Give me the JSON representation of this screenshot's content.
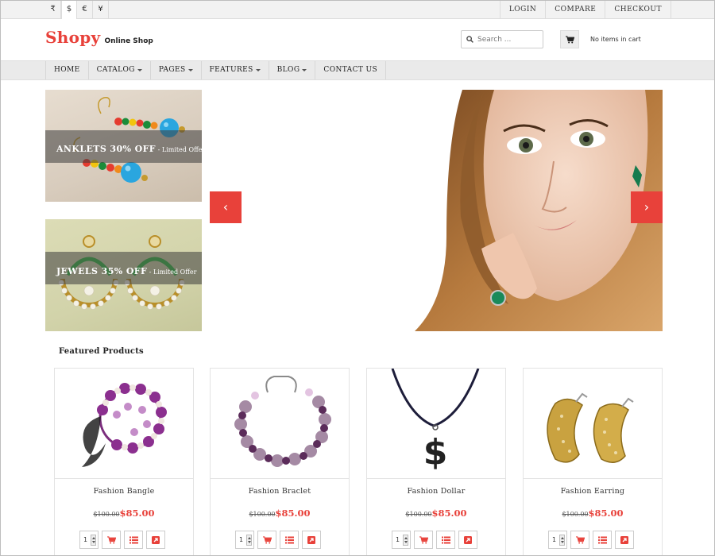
{
  "currencies": [
    "₹",
    "$",
    "€",
    "¥"
  ],
  "top_links": {
    "login": "LOGIN",
    "compare": "COMPARE",
    "checkout": "CHECKOUT"
  },
  "brand": {
    "name": "Shopy",
    "tagline": "Online Shop"
  },
  "search": {
    "placeholder": "Search ..."
  },
  "cart": {
    "text": "No items in cart"
  },
  "nav": {
    "home": "HOME",
    "catalog": "CATALOG",
    "pages": "PAGES",
    "features": "FEATURES",
    "blog": "BLOG",
    "contact": "CONTACT US"
  },
  "promos": [
    {
      "main": "ANKLETS 30% OFF",
      "sub": " - Limited Offer"
    },
    {
      "main": "JEWELS 35% OFF",
      "sub": " - Limited Offer"
    }
  ],
  "slider": {
    "prev_icon": "‹",
    "next_icon": "›"
  },
  "featured": {
    "title": "Featured Products",
    "products": [
      {
        "name": "Fashion Bangle",
        "old_price": "$100.00",
        "price": "$85.00",
        "qty": "1"
      },
      {
        "name": "Fashion Braclet",
        "old_price": "$100.00",
        "price": "$85.00",
        "qty": "1"
      },
      {
        "name": "Fashion Dollar",
        "old_price": "$100.00",
        "price": "$85.00",
        "qty": "1"
      },
      {
        "name": "Fashion Earring",
        "old_price": "$100.00",
        "price": "$85.00",
        "qty": "1"
      }
    ]
  },
  "colors": {
    "accent": "#e8413a",
    "nav_bg": "#eaeaea",
    "topbar_bg": "#f2f2f2"
  }
}
